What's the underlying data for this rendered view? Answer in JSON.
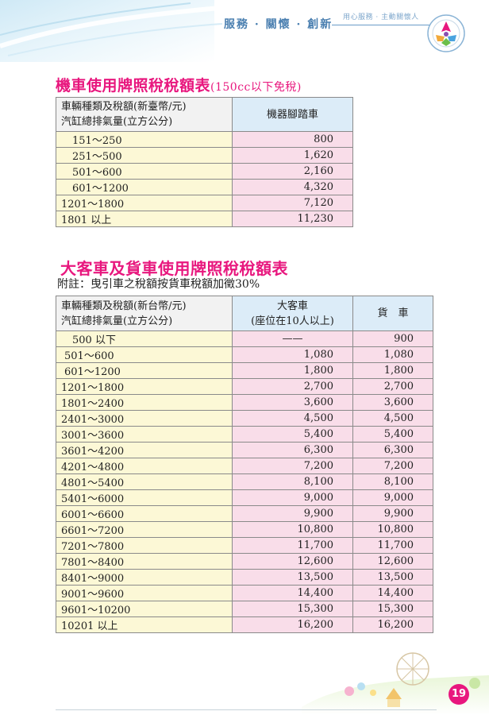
{
  "header": {
    "slogan": "服務 · 關懷 · 創新",
    "subtitle": "用心服務 · 主動關懷人"
  },
  "motorcycle": {
    "title": "機車使用牌照稅稅額表",
    "note": "(150cc以下免稅)",
    "header_cat_line1": "車輛種類及稅額(新臺幣/元)",
    "header_cat_line2": "汽缸總排氣量(立方公分)",
    "header_col": "機器腳踏車",
    "rows": [
      {
        "range": "151～250",
        "value": "800",
        "indent": 1
      },
      {
        "range": "251～500",
        "value": "1,620",
        "indent": 1
      },
      {
        "range": "501～600",
        "value": "2,160",
        "indent": 1
      },
      {
        "range": "601～1200",
        "value": "4,320",
        "indent": 1
      },
      {
        "range": "1201～1800",
        "value": "7,120",
        "indent": 0
      },
      {
        "range": "1801 以上",
        "value": "11,230",
        "indent": 0
      }
    ]
  },
  "bus_truck": {
    "title": "大客車及貨車使用牌照稅稅額表",
    "note": "附註：曳引車之稅額按貨車稅額加徵30%",
    "header_cat_line1": "車輛種類及稅額(新台幣/元)",
    "header_cat_line2": "汽缸總排氣量(立方公分)",
    "header_bus_line1": "大客車",
    "header_bus_line2": "(座位在10人以上)",
    "header_truck": "貨　車",
    "rows": [
      {
        "range": "500 以下",
        "bus": "——",
        "truck": "900",
        "indent": 1
      },
      {
        "range": "501～600",
        "bus": "1,080",
        "truck": "1,080",
        "indent": 2
      },
      {
        "range": "601～1200",
        "bus": "1,800",
        "truck": "1,800",
        "indent": 2
      },
      {
        "range": "1201～1800",
        "bus": "2,700",
        "truck": "2,700",
        "indent": 0
      },
      {
        "range": "1801～2400",
        "bus": "3,600",
        "truck": "3,600",
        "indent": 0
      },
      {
        "range": "2401～3000",
        "bus": "4,500",
        "truck": "4,500",
        "indent": 0
      },
      {
        "range": "3001～3600",
        "bus": "5,400",
        "truck": "5,400",
        "indent": 0
      },
      {
        "range": "3601～4200",
        "bus": "6,300",
        "truck": "6,300",
        "indent": 0
      },
      {
        "range": "4201～4800",
        "bus": "7,200",
        "truck": "7,200",
        "indent": 0
      },
      {
        "range": "4801～5400",
        "bus": "8,100",
        "truck": "8,100",
        "indent": 0
      },
      {
        "range": "5401～6000",
        "bus": "9,000",
        "truck": "9,000",
        "indent": 0
      },
      {
        "range": "6001～6600",
        "bus": "9,900",
        "truck": "9,900",
        "indent": 0
      },
      {
        "range": "6601～7200",
        "bus": "10,800",
        "truck": "10,800",
        "indent": 0
      },
      {
        "range": "7201～7800",
        "bus": "11,700",
        "truck": "11,700",
        "indent": 0
      },
      {
        "range": "7801～8400",
        "bus": "12,600",
        "truck": "12,600",
        "indent": 0
      },
      {
        "range": "8401～9000",
        "bus": "13,500",
        "truck": "13,500",
        "indent": 0
      },
      {
        "range": "9001～9600",
        "bus": "14,400",
        "truck": "14,400",
        "indent": 0
      },
      {
        "range": "9601～10200",
        "bus": "15,300",
        "truck": "15,300",
        "indent": 0
      },
      {
        "range": "10201 以上",
        "bus": "16,200",
        "truck": "16,200",
        "indent": 0
      }
    ]
  },
  "footer": {
    "page_number": "19"
  },
  "colors": {
    "accent": "#e8177e",
    "category_cell": "#fcf8d6",
    "value_cell": "#f9dde9",
    "header_cell": "#dcecf8"
  }
}
